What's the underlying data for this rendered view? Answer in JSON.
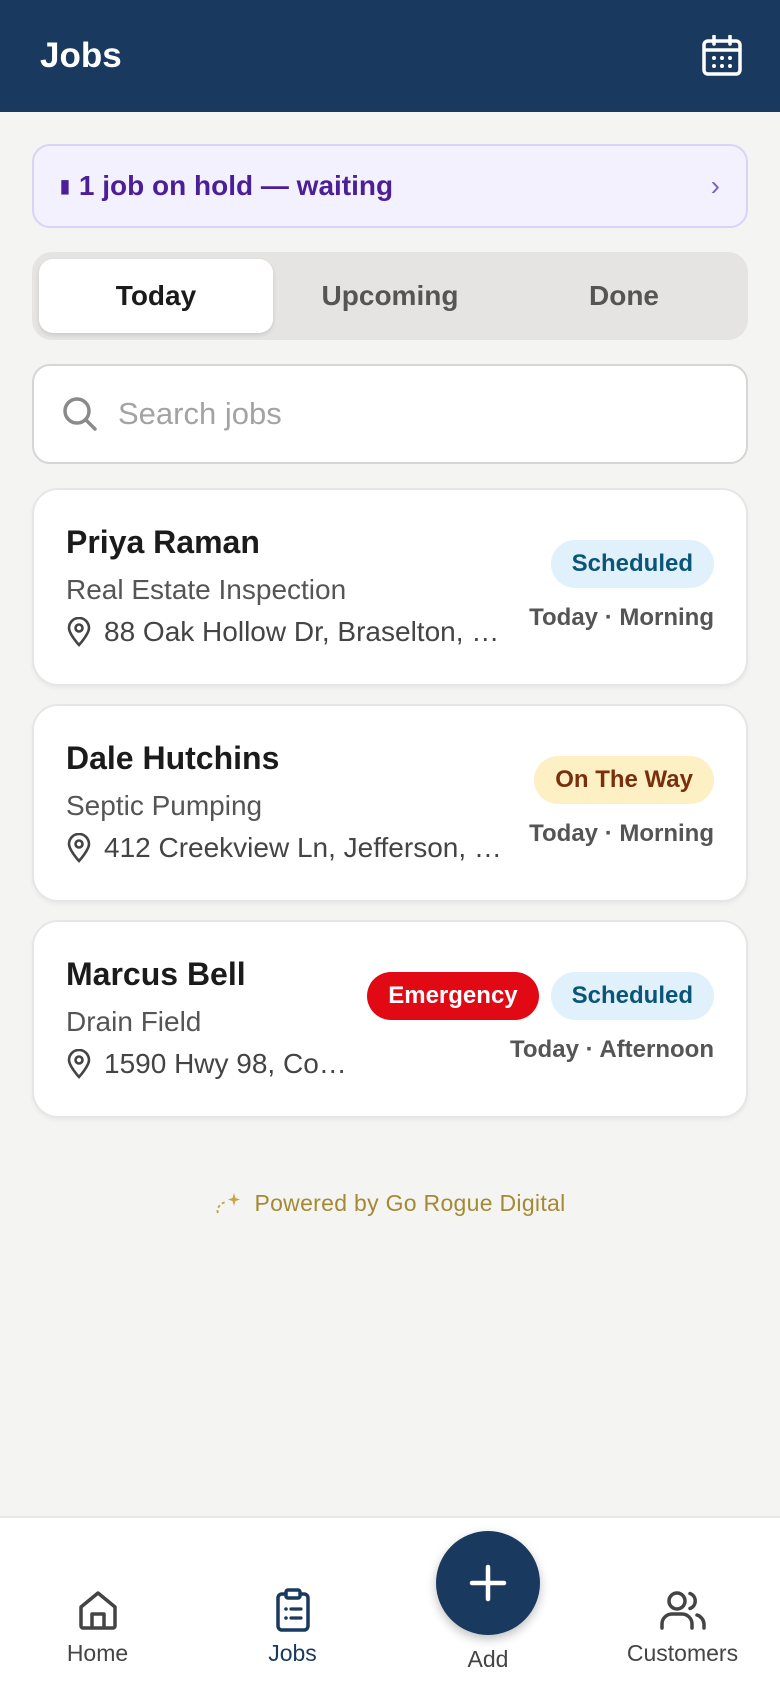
{
  "header": {
    "title": "Jobs",
    "calendar_icon": "calendar-icon"
  },
  "hold_banner": {
    "text": "1 job on hold — waiting",
    "chevron": "›",
    "icon": "pause-icon",
    "color": "#4a1f97"
  },
  "tabs": [
    {
      "label": "Today",
      "active": true
    },
    {
      "label": "Upcoming",
      "active": false
    },
    {
      "label": "Done",
      "active": false
    }
  ],
  "search": {
    "placeholder": "Search jobs",
    "value": ""
  },
  "jobs": [
    {
      "name": "Priya Raman",
      "service": "Real Estate Inspection",
      "address": "88 Oak Hollow Dr, Braselton, …",
      "badges": [
        {
          "label": "Scheduled",
          "kind": "scheduled"
        }
      ],
      "when": "Today · Morning"
    },
    {
      "name": "Dale Hutchins",
      "service": "Septic Pumping",
      "address": "412 Creekview Ln, Jefferson, …",
      "badges": [
        {
          "label": "On The Way",
          "kind": "ontheway"
        }
      ],
      "when": "Today · Morning"
    },
    {
      "name": "Marcus Bell",
      "service": "Drain Field",
      "address": "1590 Hwy 98, Co…",
      "badges": [
        {
          "label": "Emergency",
          "kind": "emergency"
        },
        {
          "label": "Scheduled",
          "kind": "scheduled"
        }
      ],
      "when": "Today · Afternoon"
    }
  ],
  "footer": {
    "powered_by": "Powered by Go Rogue Digital"
  },
  "bottom_nav": {
    "home": "Home",
    "jobs": "Jobs",
    "add": "Add",
    "customers": "Customers",
    "active": "jobs"
  },
  "colors": {
    "primary": "#19395e",
    "background": "#f4f4f3",
    "scheduled_bg": "#e1f1fc",
    "scheduled_text": "#0b5579",
    "ontheway_bg": "#fdf0c4",
    "ontheway_text": "#7a2f0c",
    "emergency_bg": "#e10914",
    "powered_text": "#a48a34"
  }
}
